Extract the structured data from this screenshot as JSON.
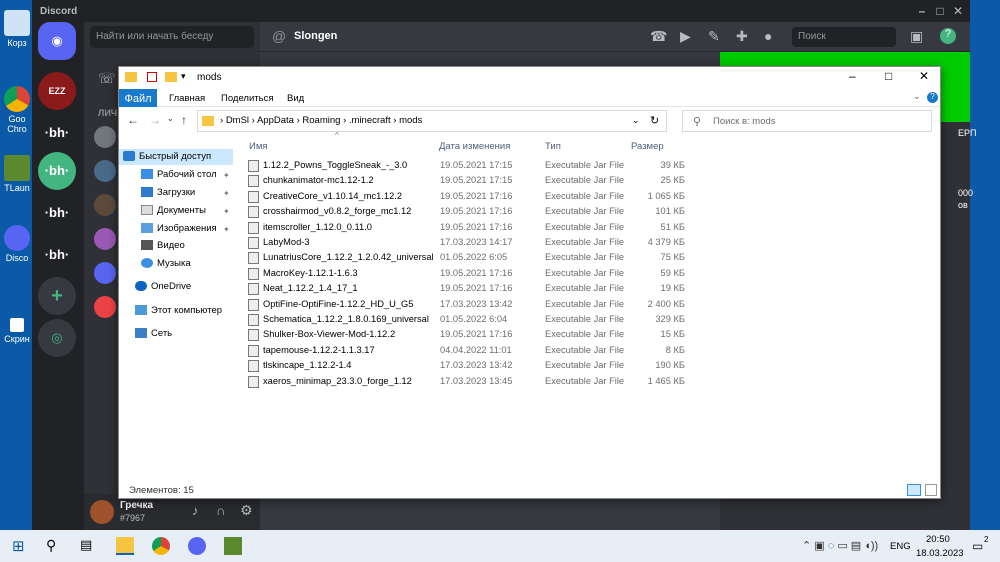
{
  "desktop": {
    "icons": [
      {
        "label": "Корз"
      },
      {
        "label": "Goo Chro"
      },
      {
        "label": "TLaun"
      },
      {
        "label": "Disco"
      },
      {
        "label": "Скрин"
      }
    ]
  },
  "discord": {
    "title": "Discord",
    "search_placeholder": "Найти или начать беседу",
    "channel_name": "Slongen",
    "header_search": "Поиск",
    "dm_label": "ЛИЧ",
    "servers": [
      {
        "label": "EZZ",
        "color": "#8b1a1a"
      },
      {
        "label": "·bh·",
        "color": "#202225"
      },
      {
        "label": "·bh·",
        "color": "#43b581"
      },
      {
        "label": "·bh·",
        "color": "#202225"
      },
      {
        "label": "·bh·",
        "color": "#202225"
      }
    ],
    "user": {
      "name": "Гречка",
      "tag": "#7967"
    },
    "right_side_text": [
      "ЕРП",
      "000",
      "ов"
    ]
  },
  "explorer": {
    "quick_title": "mods",
    "tabs": [
      "Файл",
      "Главная",
      "Поделиться",
      "Вид"
    ],
    "breadcrumb": [
      "DmSl",
      "AppData",
      "Roaming",
      ".minecraft",
      "mods"
    ],
    "search_placeholder": "Поиск в: mods",
    "nav": [
      {
        "label": "Быстрый доступ",
        "icon": "star-icon"
      },
      {
        "label": "Рабочий стол",
        "icon": "desktop-icon"
      },
      {
        "label": "Загрузки",
        "icon": "download-icon"
      },
      {
        "label": "Документы",
        "icon": "document-icon"
      },
      {
        "label": "Изображения",
        "icon": "image-icon"
      },
      {
        "label": "Видео",
        "icon": "video-icon"
      },
      {
        "label": "Музыка",
        "icon": "music-icon"
      },
      {
        "label": "OneDrive",
        "icon": "cloud-icon"
      },
      {
        "label": "Этот компьютер",
        "icon": "computer-icon"
      },
      {
        "label": "Сеть",
        "icon": "network-icon"
      }
    ],
    "columns": {
      "name": "Имя",
      "date": "Дата изменения",
      "type": "Тип",
      "size": "Размер"
    },
    "files": [
      {
        "name": "1.12.2_Powns_ToggleSneak_-_3.0",
        "date": "19.05.2021 17:15",
        "type": "Executable Jar File",
        "size": "39 КБ"
      },
      {
        "name": "chunkanimator-mc1.12-1.2",
        "date": "19.05.2021 17:15",
        "type": "Executable Jar File",
        "size": "25 КБ"
      },
      {
        "name": "CreativeCore_v1.10.14_mc1.12.2",
        "date": "19.05.2021 17:16",
        "type": "Executable Jar File",
        "size": "1 065 КБ"
      },
      {
        "name": "crosshairmod_v0.8.2_forge_mc1.12",
        "date": "19.05.2021 17:16",
        "type": "Executable Jar File",
        "size": "101 КБ"
      },
      {
        "name": "itemscroller_1.12.0_0.11.0",
        "date": "19.05.2021 17:16",
        "type": "Executable Jar File",
        "size": "51 КБ"
      },
      {
        "name": "LabyMod-3",
        "date": "17.03.2023 14:17",
        "type": "Executable Jar File",
        "size": "4 379 КБ"
      },
      {
        "name": "LunatriusCore_1.12.2_1.2.0.42_universal",
        "date": "01.05.2022 6:05",
        "type": "Executable Jar File",
        "size": "75 КБ"
      },
      {
        "name": "MacroKey-1.12.1-1.6.3",
        "date": "19.05.2021 17:16",
        "type": "Executable Jar File",
        "size": "59 КБ"
      },
      {
        "name": "Neat_1.12.2_1.4_17_1",
        "date": "19.05.2021 17:16",
        "type": "Executable Jar File",
        "size": "19 КБ"
      },
      {
        "name": "OptiFine-OptiFine-1.12.2_HD_U_G5",
        "date": "17.03.2023 13:42",
        "type": "Executable Jar File",
        "size": "2 400 КБ"
      },
      {
        "name": "Schematica_1.12.2_1.8.0.169_universal",
        "date": "01.05.2022 6:04",
        "type": "Executable Jar File",
        "size": "329 КБ"
      },
      {
        "name": "Shulker-Box-Viewer-Mod-1.12.2",
        "date": "19.05.2021 17:16",
        "type": "Executable Jar File",
        "size": "15 КБ"
      },
      {
        "name": "tapemouse-1.12.2-1.1.3.17",
        "date": "04.04.2022 11:01",
        "type": "Executable Jar File",
        "size": "8 КБ"
      },
      {
        "name": "tlskincape_1.12.2-1.4",
        "date": "17.03.2023 13:42",
        "type": "Executable Jar File",
        "size": "190 КБ"
      },
      {
        "name": "xaeros_minimap_23.3.0_forge_1.12",
        "date": "17.03.2023 13:45",
        "type": "Executable Jar File",
        "size": "1 465 КБ"
      }
    ],
    "status": "Элементов: 15"
  },
  "taskbar": {
    "lang": "ENG",
    "time": "20:50",
    "date": "18.03.2023",
    "notif_count": "2"
  }
}
